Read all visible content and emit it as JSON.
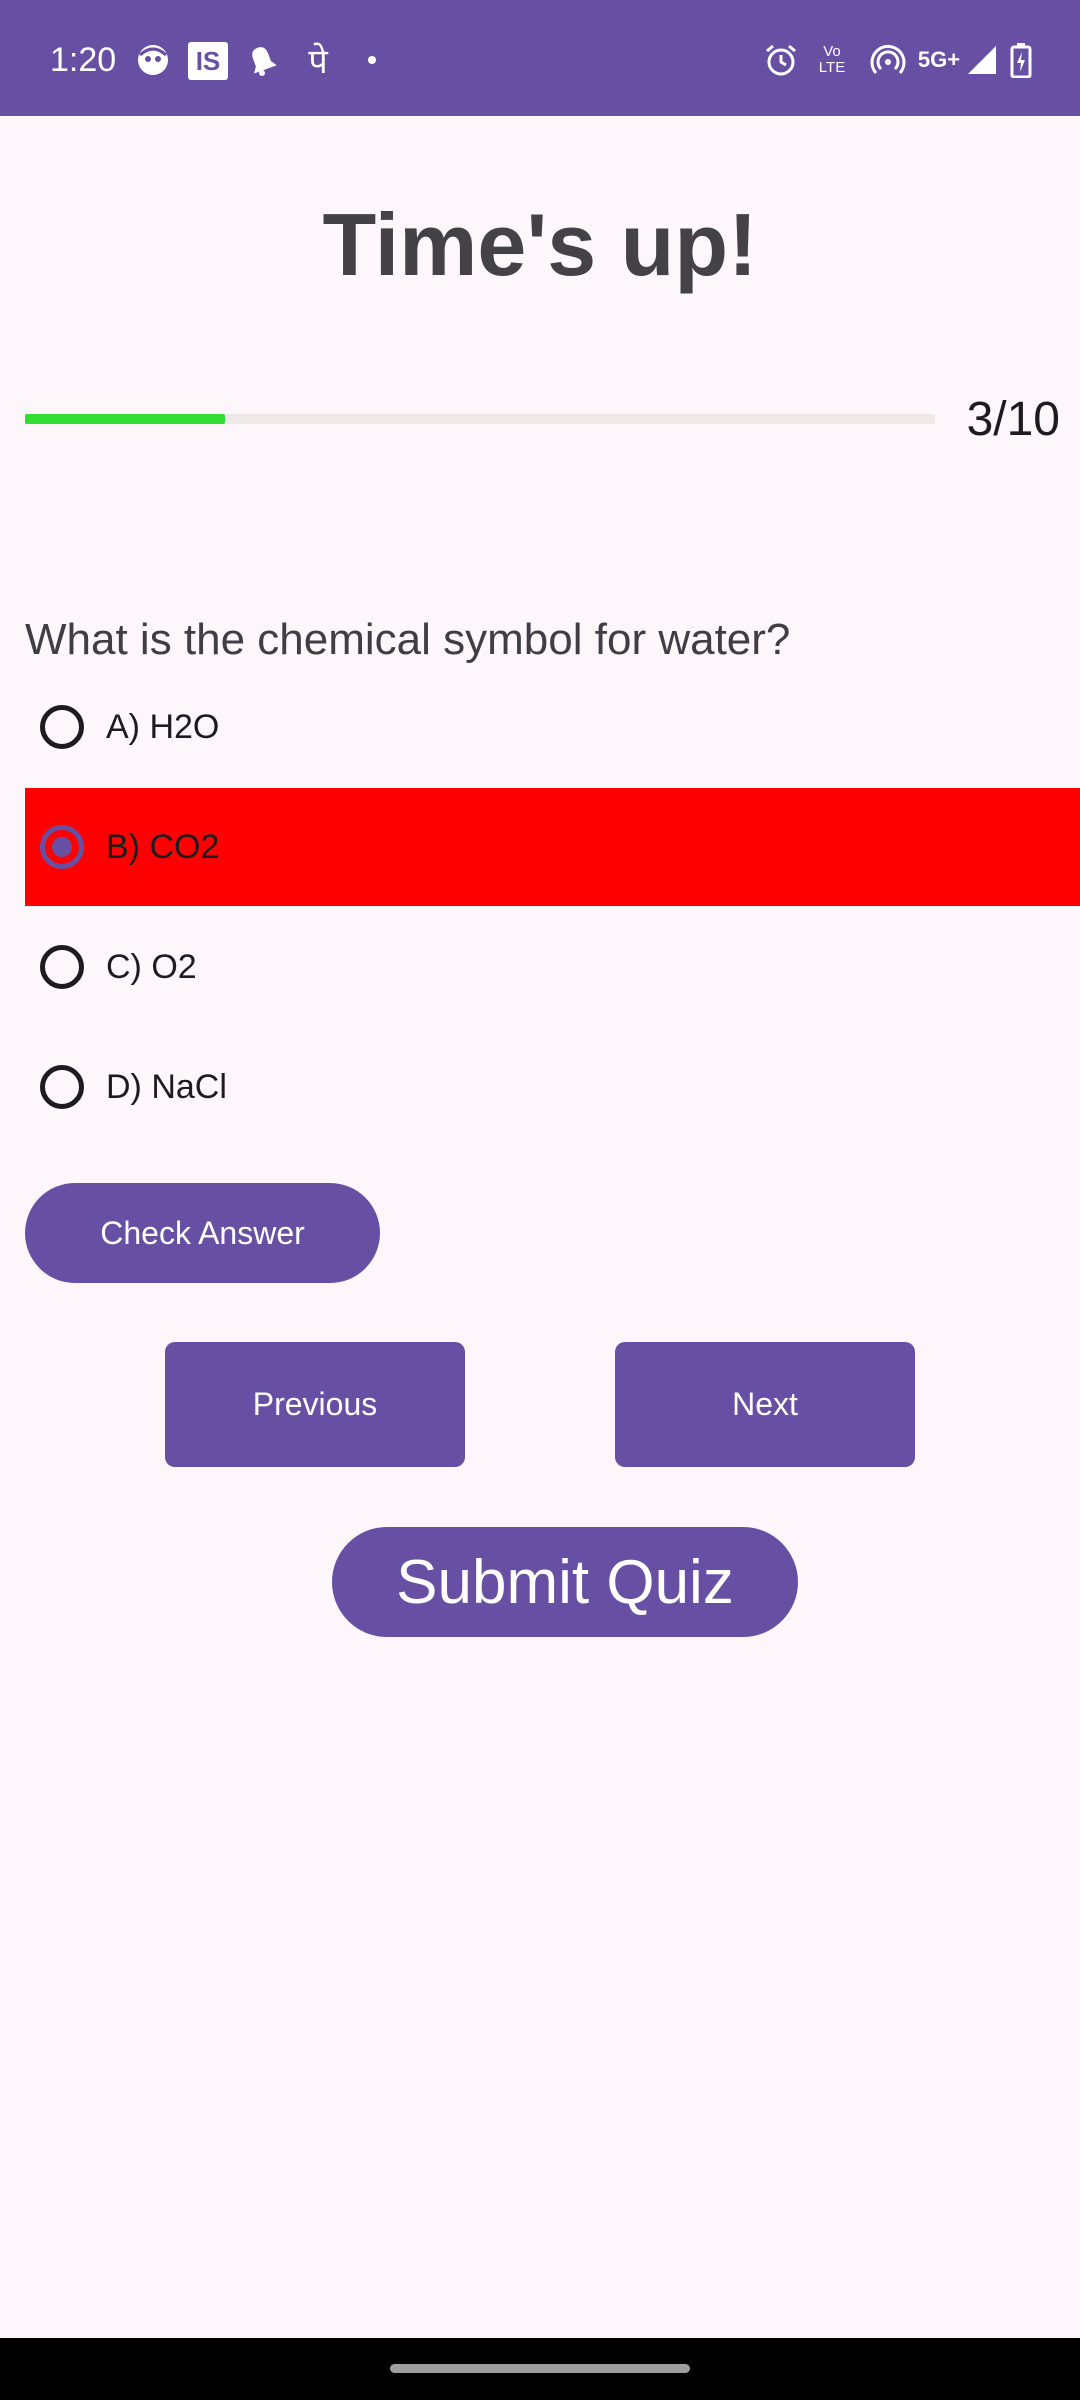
{
  "status_bar": {
    "time": "1:20",
    "is_badge": "IS",
    "pe_glyph": "पे",
    "volte_top": "Vo",
    "volte_bottom": "LTE",
    "network": "5G+",
    "icons": [
      "face-icon",
      "is-icon",
      "bell-icon",
      "pe-icon",
      "dot-icon",
      "alarm-icon",
      "volte-icon",
      "hotspot-icon",
      "5g-icon",
      "signal-icon",
      "battery-icon"
    ]
  },
  "header": {
    "title": "Time's up!"
  },
  "progress": {
    "current": 3,
    "total": 10,
    "label": "3/10",
    "fill_fraction": 0.22,
    "fill_color": "#33dd33"
  },
  "question": {
    "text": "What is the chemical symbol for water?",
    "options": [
      {
        "label": "A) H2O",
        "selected": false
      },
      {
        "label": "B) CO2",
        "selected": true
      },
      {
        "label": "C) O2",
        "selected": false
      },
      {
        "label": "D) NaCl",
        "selected": false
      }
    ],
    "selected_highlight_color": "#ff0000"
  },
  "buttons": {
    "check_answer": "Check Answer",
    "previous": "Previous",
    "next": "Next",
    "submit_quiz": "Submit Quiz"
  },
  "colors": {
    "accent": "#6750a4",
    "background": "#fdf7fc",
    "wrong_answer": "#ff0000",
    "progress": "#33dd33"
  }
}
